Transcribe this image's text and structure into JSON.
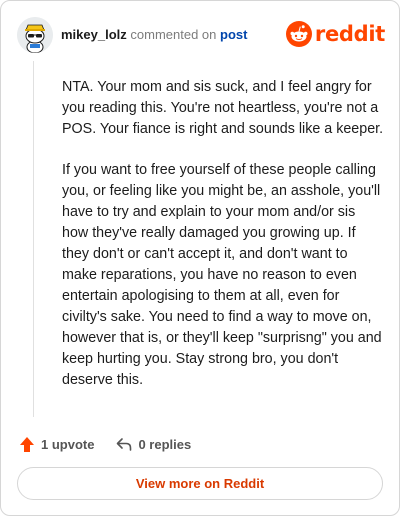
{
  "header": {
    "username": "mikey_lolz",
    "action_text": "commented on",
    "post_link": "post",
    "brand_name": "reddit"
  },
  "comment": {
    "paragraphs": [
      "NTA. Your mom and sis suck, and I feel angry for you reading this. You're not heartless, you're not a POS. Your fiance is right and sounds like a keeper.",
      "If you want to free yourself of these people calling you, or feeling like you might be, an asshole, you'll have to try and explain to your mom and/or sis how they've really damaged you growing up. If they don't or can't accept it, and don't want to make reparations, you have no reason to even entertain apologising to them at all, even for civilty's sake. You need to find a way to move on, however that is, or they'll keep \"surprisng\" you and keep hurting you. Stay strong bro, you don't deserve this."
    ]
  },
  "actions": {
    "upvote_label": "1 upvote",
    "replies_label": "0 replies"
  },
  "footer": {
    "button_label": "View more on Reddit"
  },
  "colors": {
    "brand": "#ff4500",
    "link": "#0045ac",
    "button_text": "#d93a00"
  },
  "icons": {
    "avatar": "snoo-avatar-icon",
    "brand": "reddit-logo-icon",
    "upvote": "upvote-arrow-icon",
    "reply": "reply-arrow-icon"
  }
}
